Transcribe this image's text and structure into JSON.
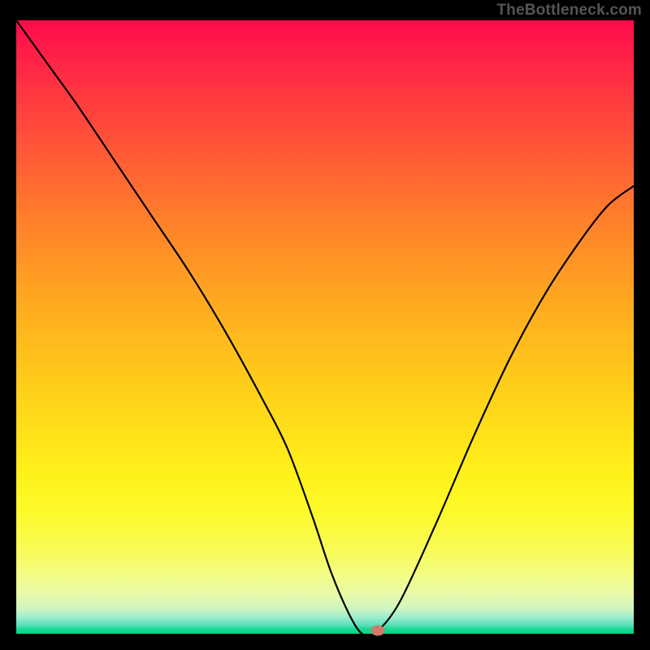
{
  "attribution": "TheBottleneck.com",
  "chart_data": {
    "type": "line",
    "title": "",
    "xlabel": "",
    "ylabel": "",
    "xlim": [
      0,
      1
    ],
    "ylim": [
      0,
      1
    ],
    "x": [
      0.0,
      0.05,
      0.1,
      0.16,
      0.22,
      0.28,
      0.34,
      0.4,
      0.44,
      0.48,
      0.51,
      0.54,
      0.56,
      0.58,
      0.62,
      0.68,
      0.74,
      0.8,
      0.86,
      0.92,
      0.96,
      1.0
    ],
    "values": [
      1.0,
      0.93,
      0.86,
      0.77,
      0.68,
      0.59,
      0.49,
      0.38,
      0.3,
      0.19,
      0.1,
      0.03,
      0.0,
      0.0,
      0.05,
      0.18,
      0.32,
      0.45,
      0.56,
      0.65,
      0.7,
      0.73
    ],
    "marker": {
      "x": 0.585,
      "y": 0.0
    }
  },
  "colors": {
    "curve": "#000000",
    "marker": "#cf7b6a",
    "background": "#000000"
  },
  "gradient_stops": [
    "#ff0a4b",
    "#ff3b3f",
    "#ff7a2c",
    "#ffb21e",
    "#ffe019",
    "#fdfa2a",
    "#f4fc7f",
    "#cdf6c0",
    "#52dfb4",
    "#0ad681"
  ]
}
